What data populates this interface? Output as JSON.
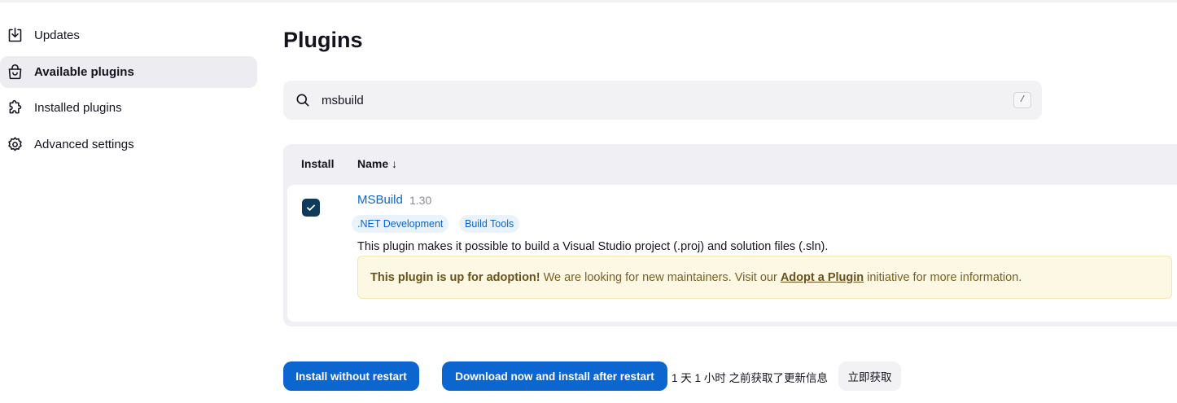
{
  "sidebar": {
    "items": [
      {
        "label": "Updates",
        "icon": "download-icon",
        "active": false
      },
      {
        "label": "Available plugins",
        "icon": "shopping-bag-icon",
        "active": true
      },
      {
        "label": "Installed plugins",
        "icon": "puzzle-icon",
        "active": false
      },
      {
        "label": "Advanced settings",
        "icon": "gear-icon",
        "active": false
      }
    ]
  },
  "main": {
    "title": "Plugins",
    "search": {
      "value": "msbuild",
      "shortcut": "/"
    },
    "table": {
      "headers": {
        "install": "Install",
        "name": "Name ↓"
      },
      "rows": [
        {
          "checked": true,
          "name": "MSBuild",
          "version": "1.30",
          "tags": [
            ".NET Development",
            "Build Tools"
          ],
          "description": "This plugin makes it possible to build a Visual Studio project (.proj) and solution files (.sln).",
          "adoption": {
            "bold": "This plugin is up for adoption!",
            "text_before": " We are looking for new maintainers. Visit our",
            "link": "Adopt a Plugin",
            "text_after": "initiative for more information."
          }
        }
      ]
    }
  },
  "footer": {
    "install_label": "Install without restart",
    "download_label": "Download now and install after restart",
    "status": "1 天 1 小时 之前获取了更新信息",
    "refresh_label": "立即获取"
  },
  "colors": {
    "accent": "#0b66d0",
    "link": "#0b65c9",
    "checkbox": "#0e3a5c",
    "adoption_bg": "#fdf8e4",
    "active_bg": "#ececf1"
  }
}
